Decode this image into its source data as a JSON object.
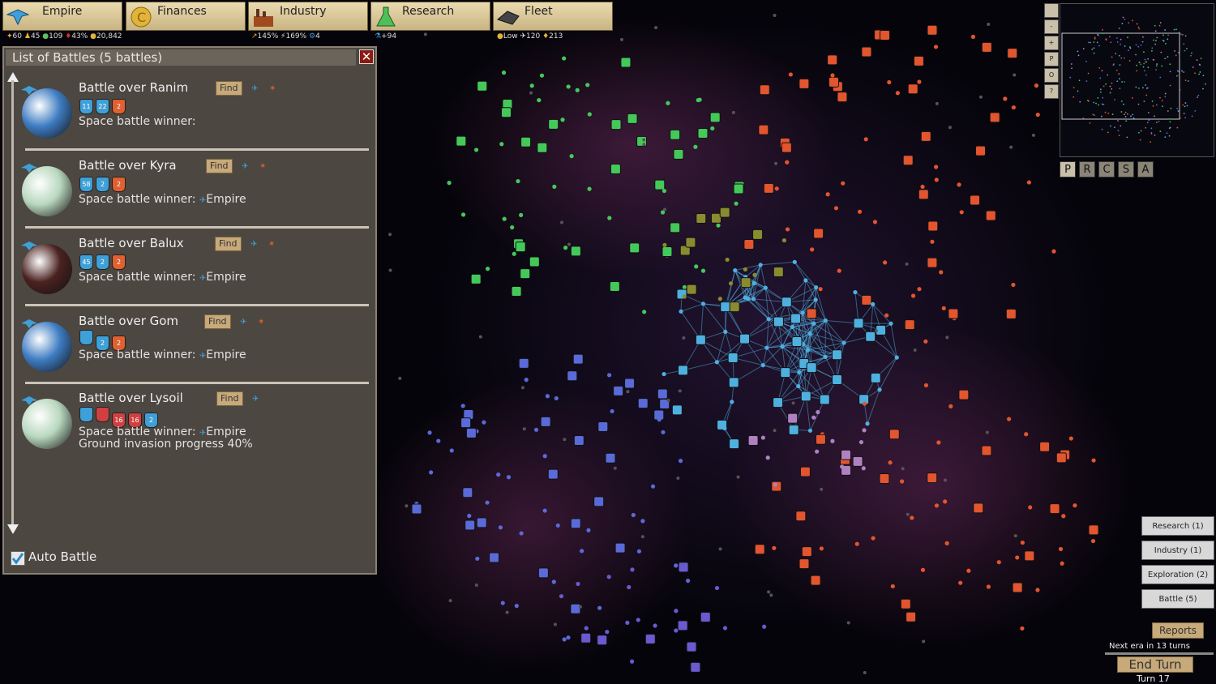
{
  "topbar": {
    "empire_label": "Empire",
    "finances_label": "Finances",
    "industry_label": "Industry",
    "research_label": "Research",
    "fleet_label": "Fleet"
  },
  "stats": {
    "empire": [
      "60",
      "45",
      "109",
      "43%",
      "20,842"
    ],
    "industry": [
      "145%",
      "169%",
      "4"
    ],
    "research": [
      "+94"
    ],
    "fleet": [
      "Low",
      "120",
      "213"
    ]
  },
  "panel": {
    "title": "List of Battles (5 battles)",
    "close": "✕",
    "auto_battle_label": "Auto Battle",
    "find_label": "Find"
  },
  "battles": [
    {
      "name": "Battle over Ranim",
      "winner": "Space battle winner:",
      "winner_empire": "",
      "ships": [
        "11",
        "22",
        "2"
      ],
      "planet_color": "#3e7cc2"
    },
    {
      "name": "Battle over Kyra",
      "winner": "Space battle winner:",
      "winner_empire": "Empire",
      "ships": [
        "58",
        "2",
        "2"
      ],
      "planet_color": "#b9d8bf"
    },
    {
      "name": "Battle over Balux",
      "winner": "Space battle winner:",
      "winner_empire": "Empire",
      "ships": [
        "45",
        "2",
        "2"
      ],
      "planet_color": "#4a2220"
    },
    {
      "name": "Battle over Gom",
      "winner": "Space battle winner:",
      "winner_empire": "Empire",
      "ships": [
        "",
        "2",
        "2"
      ],
      "planet_color": "#3e7cc2"
    },
    {
      "name": "Battle over Lysoil",
      "winner": "Space battle winner:",
      "winner_empire": "Empire",
      "extra": "Ground invasion progress 40%",
      "ships": [
        "",
        "",
        "16",
        "16",
        "2"
      ],
      "planet_color": "#b9d8bf"
    }
  ],
  "minimap": {
    "side_buttons": [
      "",
      "-",
      "+",
      "P",
      "O",
      "?"
    ],
    "tabs": [
      "P",
      "R",
      "C",
      "S",
      "A"
    ]
  },
  "right_buttons": [
    "Research (1)",
    "Industry (1)",
    "Exploration (2)",
    "Battle (5)"
  ],
  "reports_label": "Reports",
  "next_era": "Next era in 13 turns",
  "end_turn": "End Turn",
  "turn": "Turn 17",
  "colors": {
    "panel_bg": "#4d4741",
    "button": "#c7a97a",
    "accent_red": "#8b1a10"
  }
}
